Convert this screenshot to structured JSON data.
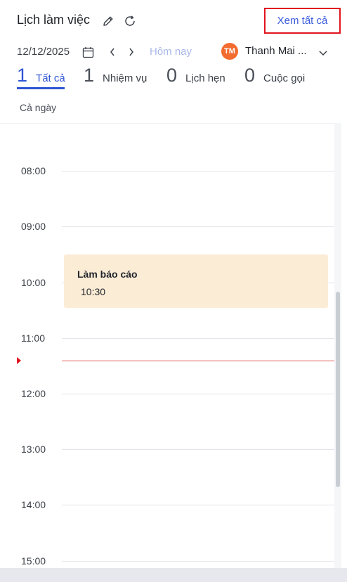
{
  "header": {
    "title": "Lịch làm việc",
    "view_all_label": "Xem tất cả"
  },
  "toolbar": {
    "date": "12/12/2025",
    "today_label": "Hôm nay",
    "user": {
      "initials": "TM",
      "name": "Thanh Mai ...",
      "avatar_color": "#f26b2f"
    }
  },
  "tabs": [
    {
      "count": "1",
      "label": "Tất cả",
      "active": true
    },
    {
      "count": "1",
      "label": "Nhiệm vụ",
      "active": false
    },
    {
      "count": "0",
      "label": "Lịch hẹn",
      "active": false
    },
    {
      "count": "0",
      "label": "Cuộc gọi",
      "active": false
    }
  ],
  "all_day_label": "Cả ngày",
  "hours": [
    "08:00",
    "09:00",
    "10:00",
    "11:00",
    "12:00",
    "13:00",
    "14:00",
    "15:00"
  ],
  "event": {
    "title": "Làm báo cáo",
    "time": "10:30",
    "color": "#fbecd6"
  },
  "colors": {
    "accent": "#2f55d4",
    "now_line": "#e25c5c",
    "highlight_border": "#e0141e"
  }
}
